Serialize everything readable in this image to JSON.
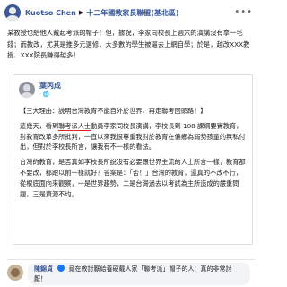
{
  "post": {
    "author": "Kuotso Chen",
    "target_group": "十二年國教家長聯盟(基北區)",
    "text": "某教授也給他人戴起考派的帽子！但，據說，李家同校長上週六的演講沒有拿一毛錢；而教改，尤其是推多元選修，大多數的學生被逼去上網自學；於是，越改XXX教授、XXX院長賺得越多！"
  },
  "shared": {
    "author": "葉丙成",
    "meta": "· 🌐",
    "paragraphs": [
      "【三大理由：說明台灣教育不能自外於世界、再走聯考回頭路！】",
      "這幾天，看到聯考派人士動員李家同校長演講，李校長到 108 課綱要實教育，對教育改革多所批判，一直以來我很尊重我對於教育在偏鄉為弱勢孩童的無私付出，但對於李校長所言，讓我有不一樣的看法。",
      "台灣的教育，是否真如李校長所說沒有必要跟世界主流的人士所言一樣，教育都不要改，都跟以前一樣就好？答案是：「否！」台灣的教育，還真的不改不行，從根底面向來觀察，一是世界趨勢，二是台灣過去以考試為主所造成的嚴重問題，三是資源不均。"
    ],
    "underline_phrase": "聯考派人士"
  },
  "comment": {
    "author": "陳錦貞",
    "text": "竟在教討厭給養硬戴人家「聯考派」帽子的人！真的非常討厭！"
  },
  "icons": {
    "more": "more-dots-icon",
    "caret": "caret-right-icon",
    "globe": "globe-icon"
  },
  "colors": {
    "link_blue": "#385898",
    "underline_red": "#e02020",
    "bubble_gray": "#f2f3f5"
  }
}
